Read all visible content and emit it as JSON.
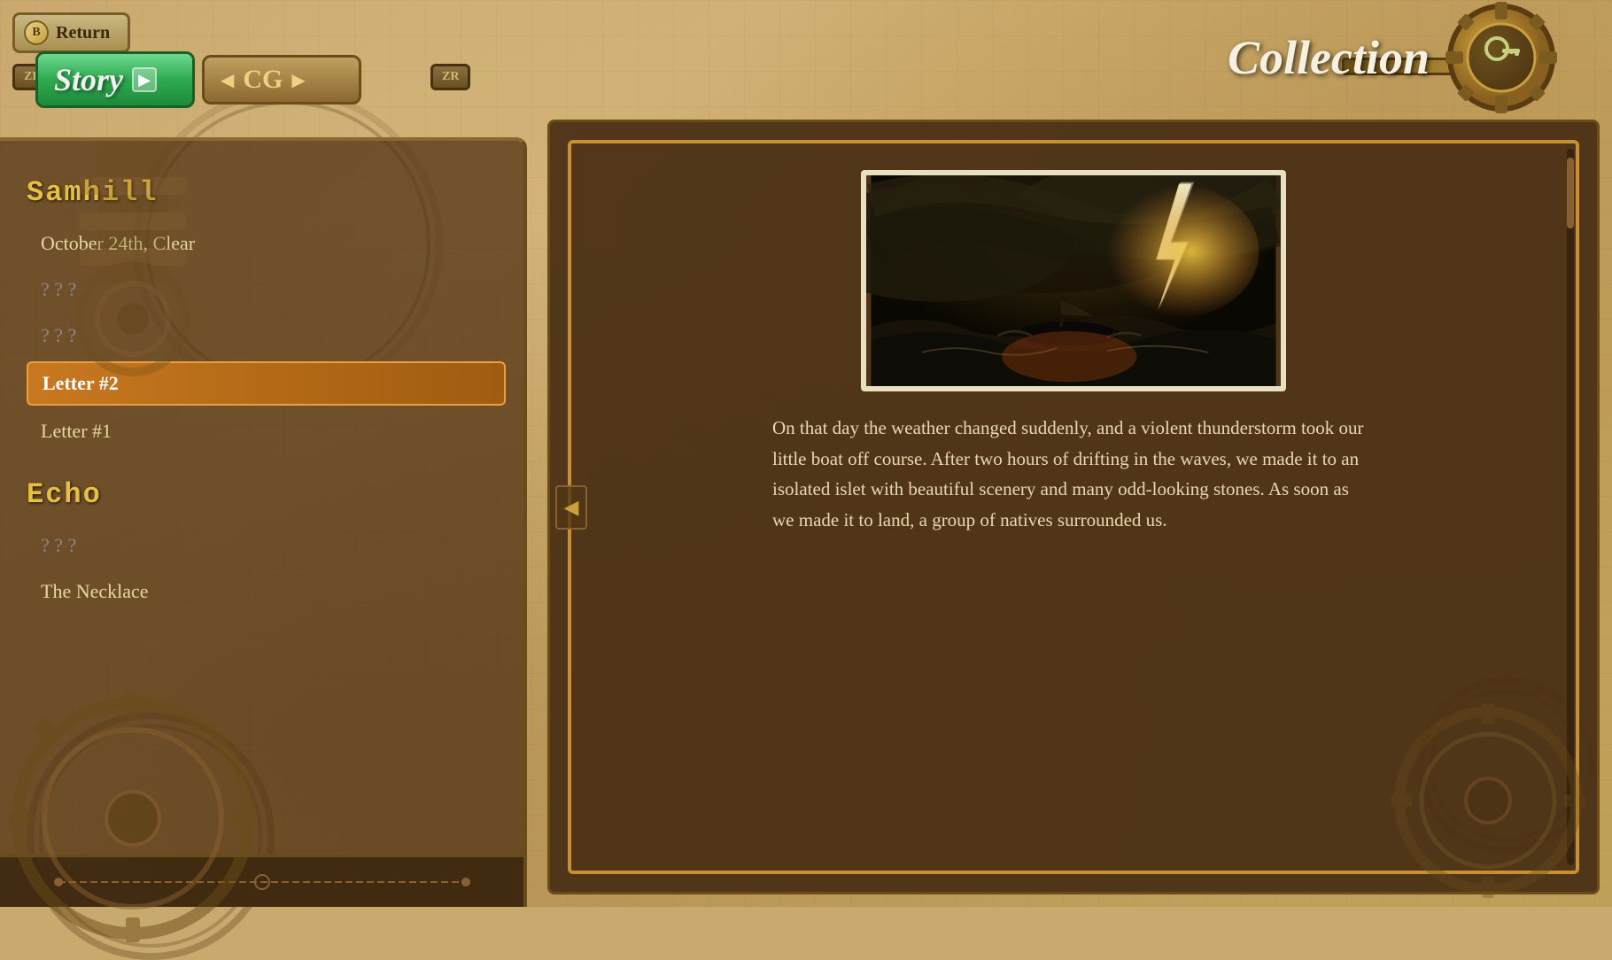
{
  "header": {
    "return_label": "Return",
    "b_label": "B",
    "zl_label": "ZL",
    "zr_label": "ZR",
    "collection_label": "Collection"
  },
  "tabs": [
    {
      "id": "story",
      "label": "Story",
      "active": true
    },
    {
      "id": "cg",
      "label": "CG",
      "active": false
    }
  ],
  "left_panel": {
    "chapters": [
      {
        "id": "samhill",
        "name": "Samhill",
        "items": [
          {
            "id": "oct24",
            "text": "October 24th, Clear",
            "locked": false,
            "selected": false
          },
          {
            "id": "q1",
            "text": "? ? ?",
            "locked": true,
            "selected": false
          },
          {
            "id": "q2",
            "text": "? ? ?",
            "locked": true,
            "selected": false
          },
          {
            "id": "letter2",
            "text": "Letter #2",
            "locked": false,
            "selected": true
          },
          {
            "id": "letter1",
            "text": "Letter #1",
            "locked": false,
            "selected": false
          }
        ]
      },
      {
        "id": "echo",
        "name": "Echo",
        "items": [
          {
            "id": "q3",
            "text": "? ? ?",
            "locked": true,
            "selected": false
          },
          {
            "id": "necklace",
            "text": "The Necklace",
            "locked": false,
            "selected": false
          }
        ]
      }
    ]
  },
  "right_panel": {
    "story_text": "On that day the weather changed suddenly, and a violent thunderstorm took our little boat off course. After two hours of drifting in the waves, we made it to an isolated islet with beautiful scenery and many odd-looking stones. As soon as we made it to land, a group of natives surrounded us.",
    "nav_arrow": "◀"
  },
  "colors": {
    "accent_gold": "#c89030",
    "dark_brown": "#3a2010",
    "panel_bg": "#4a3012",
    "selected_bg": "#c87820",
    "text_light": "#e8d8a0",
    "chapter_color": "#e8c040"
  }
}
